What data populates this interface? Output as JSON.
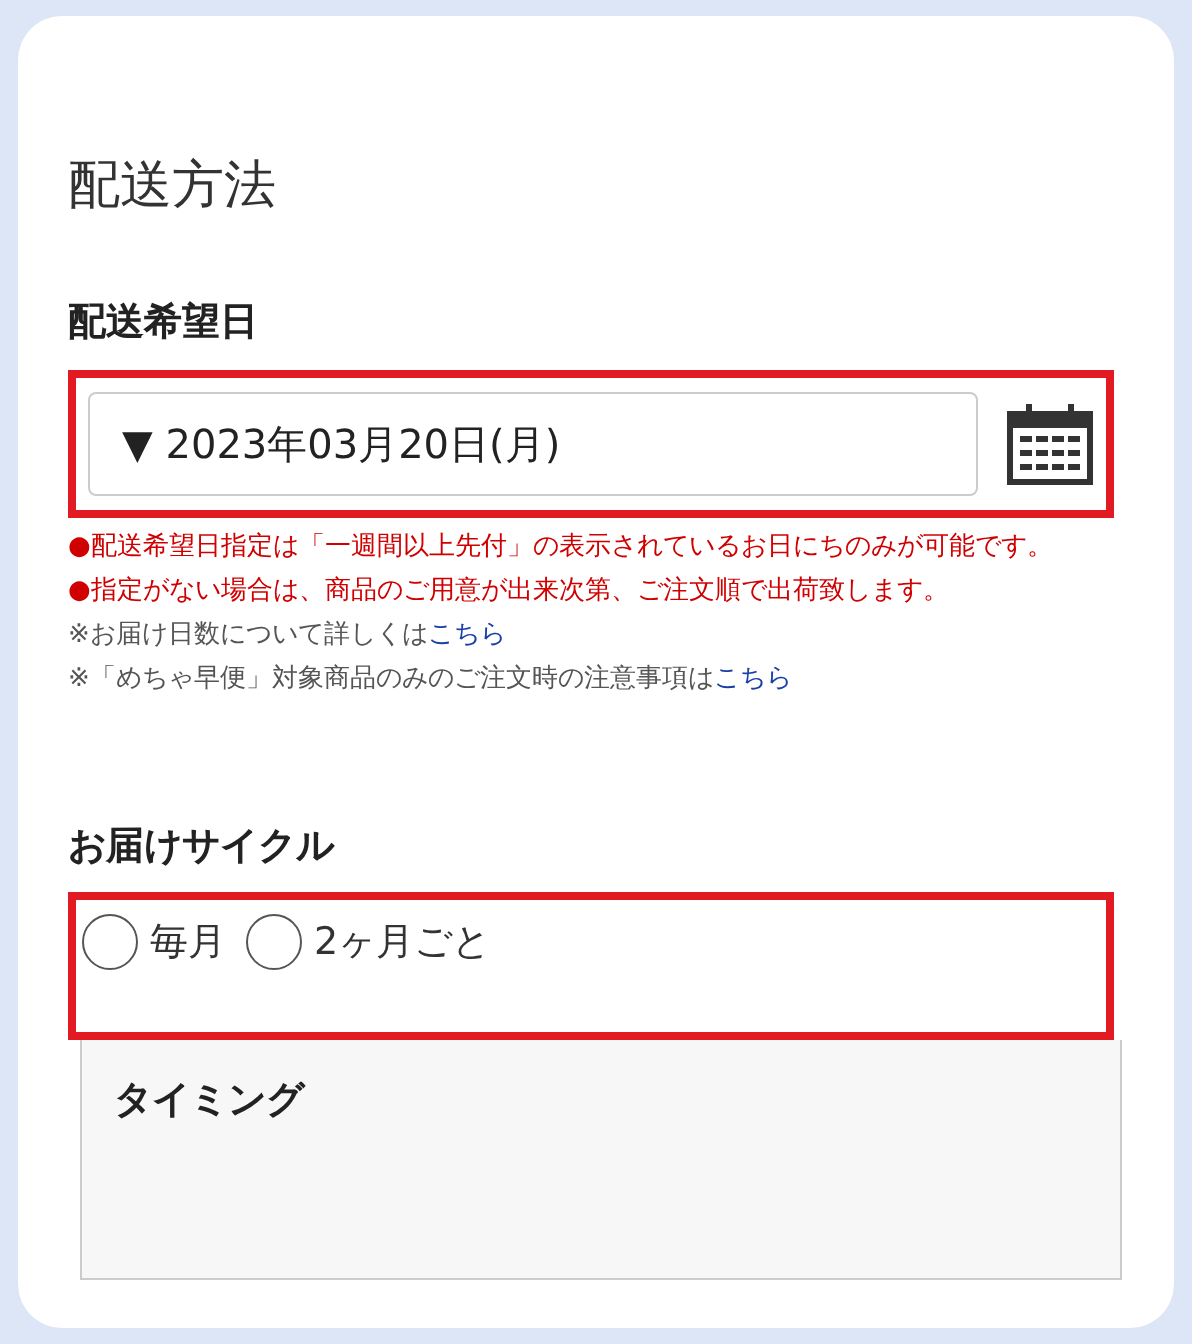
{
  "section_title": "配送方法",
  "delivery_date": {
    "label": "配送希望日",
    "value": "▼ 2023年03月20日(月)",
    "highlighted": true
  },
  "notes": [
    {
      "kind": "warning",
      "text": "●配送希望日指定は「一週間以上先付」の表示されているお日にちのみが可能です。"
    },
    {
      "kind": "warning",
      "text": "●指定がない場合は、商品のご用意が出来次第、ご注文順で出荷致します。"
    },
    {
      "kind": "info",
      "text": "※お届け日数について詳しくは",
      "link": "こちら"
    },
    {
      "kind": "info",
      "text": "※「めちゃ早便」対象商品のみのご注文時の注意事項は",
      "link": "こちら"
    }
  ],
  "delivery_cycle": {
    "label": "お届けサイクル",
    "highlighted": true,
    "options": [
      {
        "label": "毎月",
        "selected": false
      },
      {
        "label": "2ヶ月ごと",
        "selected": false
      }
    ]
  },
  "timing": {
    "label": "タイミング"
  }
}
